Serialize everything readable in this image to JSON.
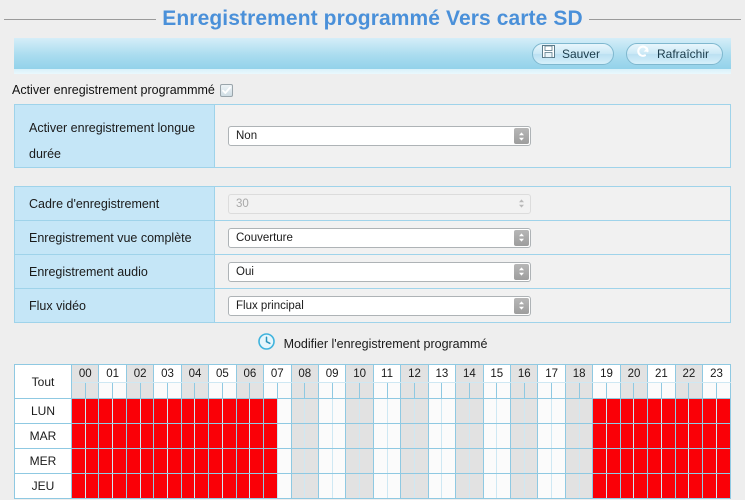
{
  "page": {
    "title": "Enregistrement programmé Vers carte SD"
  },
  "toolbar": {
    "save_label": "Sauver",
    "refresh_label": "Rafraîchir",
    "save_icon": "floppy-disk-icon",
    "refresh_icon": "refresh-arrow-icon"
  },
  "enable": {
    "label": "Activer enregistrement programmmé",
    "checked": true
  },
  "panel_main": {
    "rows": [
      {
        "label": "Activer enregistrement longue durée",
        "value": "Non",
        "type": "select",
        "disabled": false
      }
    ]
  },
  "panel_settings": {
    "rows": [
      {
        "label": "Cadre d'enregistrement",
        "value": "30",
        "type": "select",
        "disabled": true
      },
      {
        "label": "Enregistrement vue complète",
        "value": "Couverture",
        "type": "select",
        "disabled": false
      },
      {
        "label": "Enregistrement audio",
        "value": "Oui",
        "type": "select",
        "disabled": false
      },
      {
        "label": "Flux vidéo",
        "value": "Flux principal",
        "type": "select",
        "disabled": false
      }
    ]
  },
  "modify_link": {
    "label": "Modifier l'enregistrement programmé",
    "icon": "clock-icon"
  },
  "schedule": {
    "all_label": "Tout",
    "hours": [
      "00",
      "01",
      "02",
      "03",
      "04",
      "05",
      "06",
      "07",
      "08",
      "09",
      "10",
      "11",
      "12",
      "13",
      "14",
      "15",
      "16",
      "17",
      "18",
      "19",
      "20",
      "21",
      "22",
      "23"
    ],
    "days": [
      "LUN",
      "MAR",
      "MER",
      "JEU"
    ],
    "selected_half_hours": {
      "LUN": [
        0,
        1,
        2,
        3,
        4,
        5,
        6,
        7,
        8,
        9,
        10,
        11,
        12,
        13,
        14,
        38,
        39,
        40,
        41,
        42,
        43,
        44,
        45,
        46,
        47
      ],
      "MAR": [
        0,
        1,
        2,
        3,
        4,
        5,
        6,
        7,
        8,
        9,
        10,
        11,
        12,
        13,
        14,
        38,
        39,
        40,
        41,
        42,
        43,
        44,
        45,
        46,
        47
      ],
      "MER": [
        0,
        1,
        2,
        3,
        4,
        5,
        6,
        7,
        8,
        9,
        10,
        11,
        12,
        13,
        14,
        38,
        39,
        40,
        41,
        42,
        43,
        44,
        45,
        46,
        47
      ],
      "JEU": [
        0,
        1,
        2,
        3,
        4,
        5,
        6,
        7,
        8,
        9,
        10,
        11,
        12,
        13,
        14,
        38,
        39,
        40,
        41,
        42,
        43,
        44,
        45,
        46,
        47
      ]
    }
  },
  "colors": {
    "accent": "#4a90d9",
    "label_cell": "#c5e6f7",
    "selected": "#fa0007",
    "grid_line": "#8fc9e2"
  }
}
